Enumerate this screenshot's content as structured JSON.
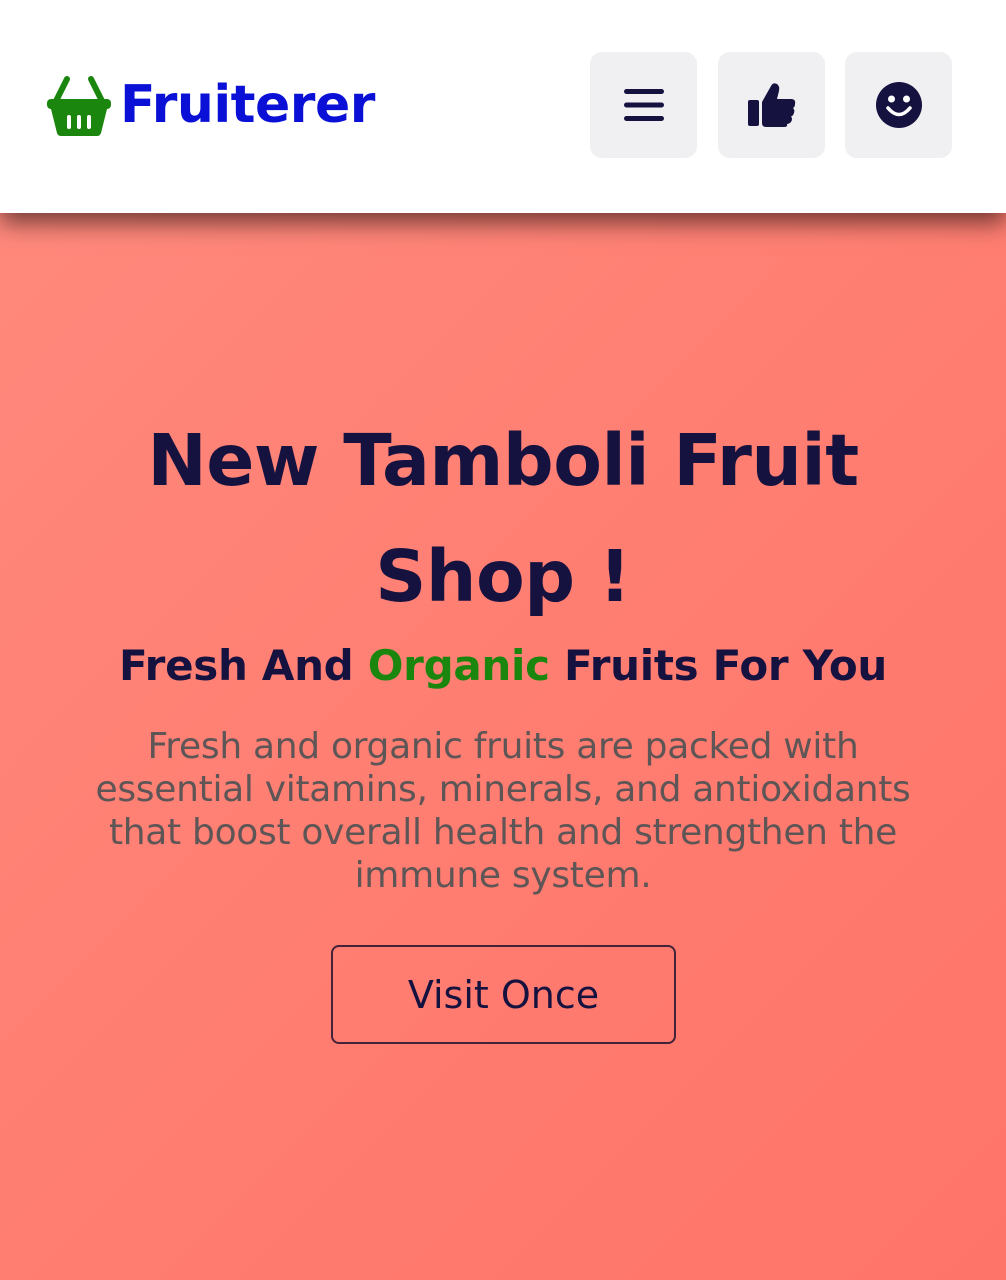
{
  "header": {
    "brand": "Fruiterer",
    "brand_color": "#0a10d6",
    "logo_icon": "shopping-basket-icon",
    "logo_icon_color": "#1a860e",
    "buttons": [
      {
        "icon": "menu-icon"
      },
      {
        "icon": "thumbs-up-icon"
      },
      {
        "icon": "smiley-face-icon"
      }
    ]
  },
  "hero": {
    "title": "New Tamboli Fruit Shop !",
    "subtitle_before": "Fresh And ",
    "subtitle_accent": "Organic",
    "subtitle_after": " Fruits For You",
    "accent_color": "#1a860e",
    "description": "Fresh and organic fruits are packed with essential vitamins, minerals, and antioxidants that boost overall health and strengthen the immune system.",
    "cta_label": "Visit Once"
  }
}
